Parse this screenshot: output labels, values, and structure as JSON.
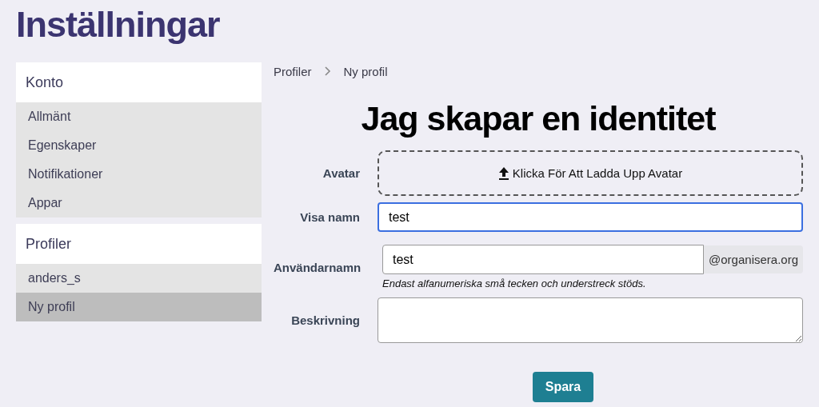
{
  "page_title": "Inställningar",
  "sidebar": [
    {
      "heading": "Konto",
      "items": [
        {
          "label": "Allmänt",
          "selected": false
        },
        {
          "label": "Egenskaper",
          "selected": false
        },
        {
          "label": "Notifikationer",
          "selected": false
        },
        {
          "label": "Appar",
          "selected": false
        }
      ]
    },
    {
      "heading": "Profiler",
      "items": [
        {
          "label": "anders_s",
          "selected": false
        },
        {
          "label": "Ny profil",
          "selected": true
        }
      ]
    }
  ],
  "breadcrumb": [
    "Profiler",
    "Ny profil"
  ],
  "heading": "Jag skapar en identitet",
  "form": [
    {
      "kind": "upload",
      "label": "Avatar",
      "text": "Klicka För Att Ladda Upp Avatar"
    },
    {
      "kind": "text",
      "label": "Visa namn",
      "value": "test",
      "focused": true
    },
    {
      "kind": "addon",
      "label": "Användarnamn",
      "value": "test",
      "addon": "@organisera.org",
      "hint": "Endast alfanumeriska små tecken och understreck stöds.",
      "focused": false
    },
    {
      "kind": "textarea",
      "label": "Beskrivning"
    }
  ],
  "submit": "Spara"
}
